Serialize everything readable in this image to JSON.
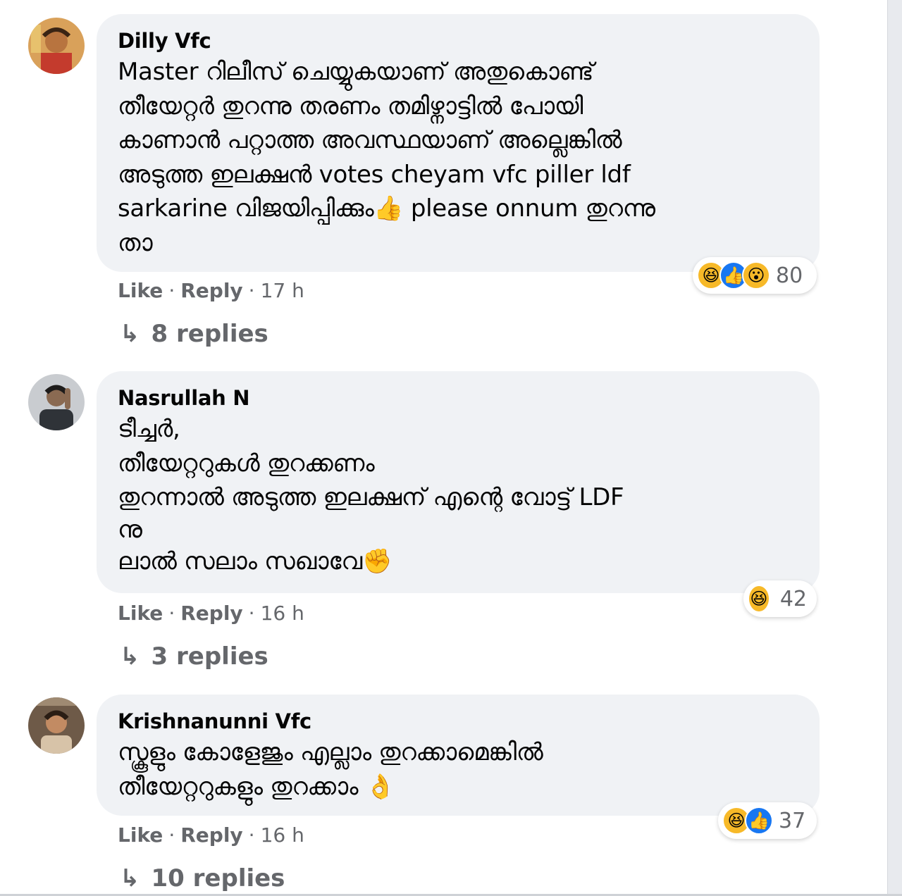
{
  "comments": [
    {
      "author": "Dilly Vfc",
      "lines": [
        "Master റിലീസ് ചെയ്യുകയാണ് അതുകൊണ്ട്",
        "തീയേറ്റർ തുറന്നു തരണം തമിഴ്നാട്ടിൽ പോയി",
        "കാണാൻ പറ്റാത്ത അവസ്ഥയാണ് അല്ലെങ്കിൽ",
        "അടുത്ത ഇലക്ഷൻ votes cheyam vfc piller ldf",
        "sarkarine വിജയിപ്പിക്കും👍 please onnum തുറന്നു",
        "താ"
      ],
      "reaction_icons": [
        "haha-icon",
        "like-icon",
        "wow-icon"
      ],
      "reaction_count": "80",
      "like_label": "Like",
      "reply_label": "Reply",
      "time": "17 h",
      "replies_label": "8 replies"
    },
    {
      "author": "Nasrullah N",
      "lines": [
        "ടീച്ചർ,",
        "തീയേറ്ററുകൾ തുറക്കണം",
        "തുറന്നാൽ അടുത്ത ഇലക്ഷന് എന്റെ വോട്ട് LDF",
        "നു",
        "ലാൽ സലാം സഖാവേ✊"
      ],
      "reaction_icons": [
        "haha-icon"
      ],
      "reaction_count": "42",
      "like_label": "Like",
      "reply_label": "Reply",
      "time": "16 h",
      "replies_label": "3 replies"
    },
    {
      "author": "Krishnanunni Vfc",
      "lines": [
        "സ്കൂളും കോളേജും എല്ലാം തുറക്കാമെങ്കിൽ",
        "തീയേറ്ററുകളും തുറക്കാം 👌"
      ],
      "reaction_icons": [
        "haha-icon",
        "like-icon"
      ],
      "reaction_count": "37",
      "like_label": "Like",
      "reply_label": "Reply",
      "time": "16 h",
      "replies_label": "10 replies"
    }
  ],
  "colors": {
    "bubble": "#f0f2f5",
    "secondary_text": "#65676b",
    "like_blue": "#1877f2",
    "haha_yellow": "#f7b928"
  }
}
